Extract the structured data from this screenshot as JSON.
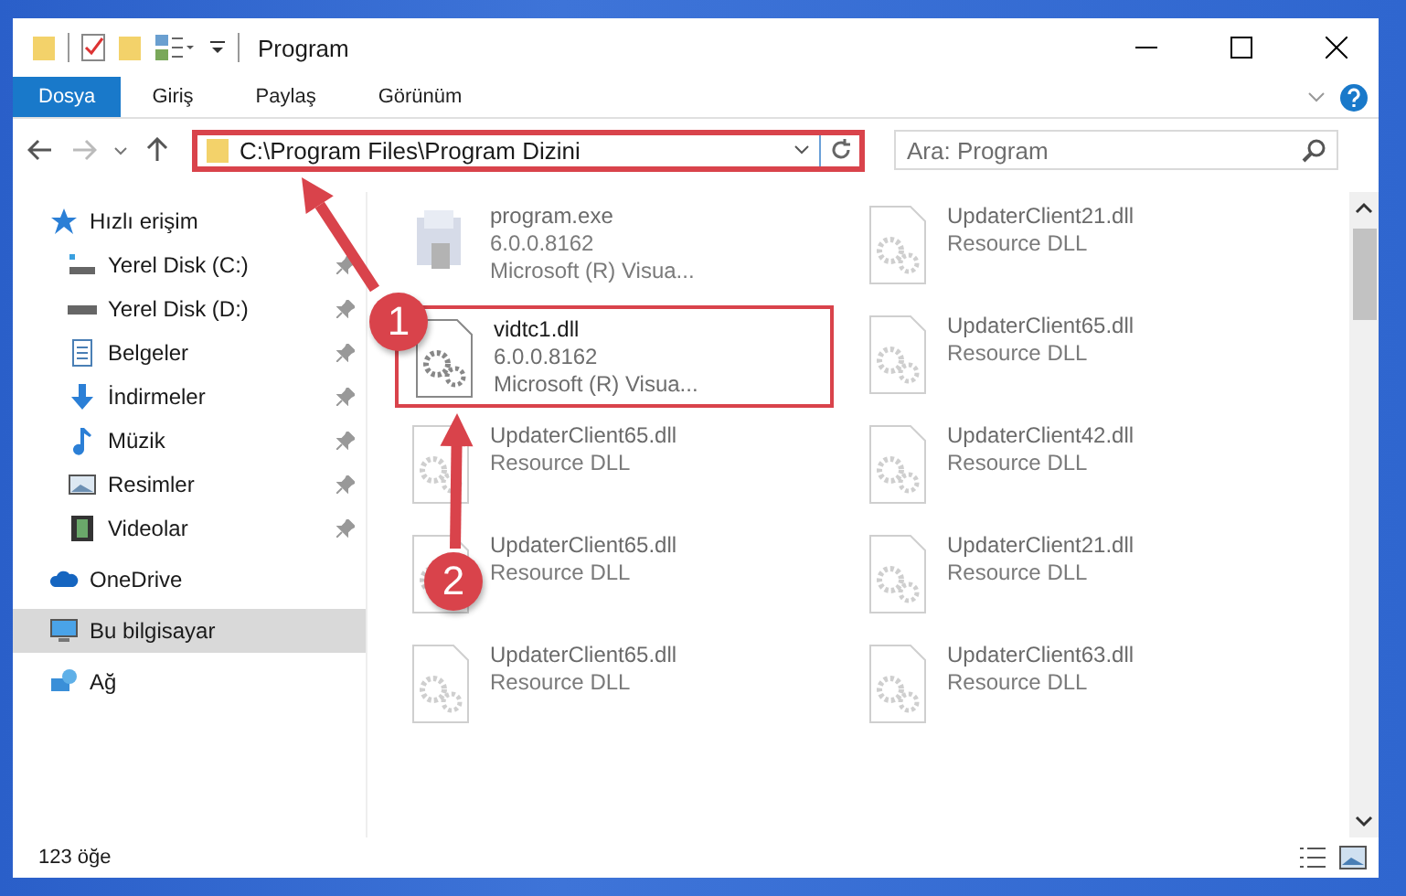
{
  "window": {
    "title": "Program"
  },
  "ribbon": {
    "tabs": [
      {
        "label": "Dosya",
        "selected": true
      },
      {
        "label": "Giriş",
        "selected": false
      },
      {
        "label": "Paylaş",
        "selected": false
      },
      {
        "label": "Görünüm",
        "selected": false
      }
    ]
  },
  "address": {
    "path": "C:\\Program Files\\Program Dizini",
    "highlighted": true
  },
  "search": {
    "placeholder": "Ara: Program"
  },
  "sidebar": {
    "items": [
      {
        "label": "Hızlı erişim",
        "selected": false,
        "children": [
          {
            "label": "Yerel Disk (C:)",
            "pinned": true,
            "selected": false
          },
          {
            "label": "Yerel Disk (D:)",
            "pinned": true,
            "selected": false
          },
          {
            "label": "Belgeler",
            "pinned": true,
            "selected": false
          },
          {
            "label": "İndirmeler",
            "pinned": true,
            "selected": false
          },
          {
            "label": "Müzik",
            "pinned": true,
            "selected": false
          },
          {
            "label": "Resimler",
            "pinned": true,
            "selected": false
          },
          {
            "label": "Videolar",
            "pinned": true,
            "selected": false
          }
        ]
      },
      {
        "label": "OneDrive",
        "selected": false
      },
      {
        "label": "Bu bilgisayar",
        "selected": true
      },
      {
        "label": "Ağ",
        "selected": false
      }
    ]
  },
  "files": [
    {
      "name": "program.exe",
      "lines": [
        "6.0.0.8162",
        "Microsoft (R) Visua..."
      ],
      "kind": "exe",
      "highlighted": false
    },
    {
      "name": "UpdaterClient21.dll",
      "lines": [
        "Resource DLL"
      ],
      "kind": "dll",
      "highlighted": false
    },
    {
      "name": "vidtc1.dll",
      "lines": [
        "6.0.0.8162",
        "Microsoft (R) Visua..."
      ],
      "kind": "dll",
      "highlighted": true
    },
    {
      "name": "UpdaterClient65.dll",
      "lines": [
        "Resource DLL"
      ],
      "kind": "dll",
      "highlighted": false
    },
    {
      "name": "UpdaterClient65.dll",
      "lines": [
        "Resource DLL"
      ],
      "kind": "dll",
      "highlighted": false
    },
    {
      "name": "UpdaterClient42.dll",
      "lines": [
        "Resource DLL"
      ],
      "kind": "dll",
      "highlighted": false
    },
    {
      "name": "UpdaterClient65.dll",
      "lines": [
        "Resource DLL"
      ],
      "kind": "dll",
      "highlighted": false
    },
    {
      "name": "UpdaterClient21.dll",
      "lines": [
        "Resource DLL"
      ],
      "kind": "dll",
      "highlighted": false
    },
    {
      "name": "UpdaterClient65.dll",
      "lines": [
        "Resource DLL"
      ],
      "kind": "dll",
      "highlighted": false
    },
    {
      "name": "UpdaterClient63.dll",
      "lines": [
        "Resource DLL"
      ],
      "kind": "dll",
      "highlighted": false
    }
  ],
  "annotations": [
    {
      "label": "1"
    },
    {
      "label": "2"
    }
  ],
  "status_bar": {
    "count": "123 öğe"
  }
}
